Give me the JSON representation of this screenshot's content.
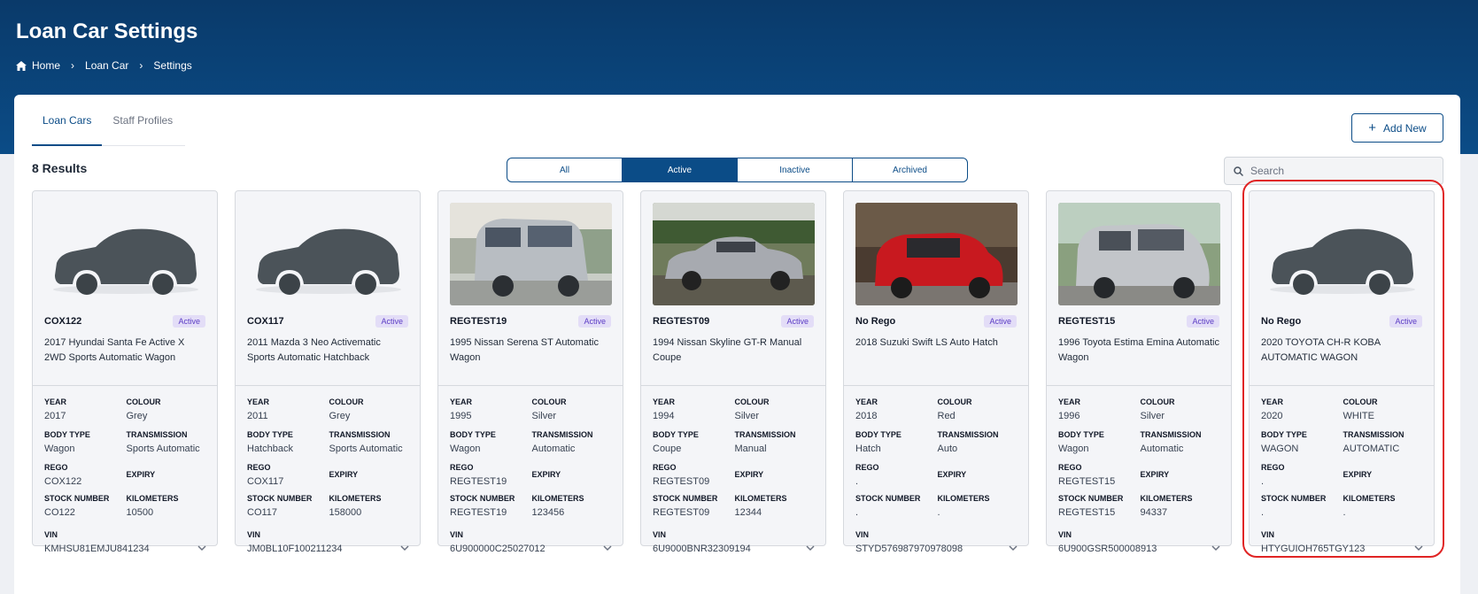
{
  "header": {
    "title": "Loan Car Settings",
    "breadcrumb": [
      "Home",
      "Loan Car",
      "Settings"
    ]
  },
  "tabs": [
    {
      "label": "Loan Cars",
      "active": true
    },
    {
      "label": "Staff Profiles",
      "active": false
    }
  ],
  "add_new_label": "Add New",
  "results_label": "8 Results",
  "filters": [
    {
      "label": "All"
    },
    {
      "label": "Active",
      "active": true
    },
    {
      "label": "Inactive"
    },
    {
      "label": "Archived"
    }
  ],
  "search": {
    "placeholder": "Search",
    "value": ""
  },
  "labels": {
    "year": "YEAR",
    "colour": "COLOUR",
    "body_type": "BODY TYPE",
    "transmission": "TRANSMISSION",
    "rego": "REGO",
    "expiry": "EXPIRY",
    "stock_number": "STOCK NUMBER",
    "kilometers": "KILOMETERS",
    "vin": "VIN"
  },
  "colors": {
    "primary": "#0b4c87",
    "badge_bg": "#e3ddf7",
    "badge_text": "#5b3cc4",
    "highlight": "#e02424"
  },
  "cars": [
    {
      "rego": "COX122",
      "status": "Active",
      "desc": "2017 Hyundai Santa Fe Active X 2WD Sports Automatic Wagon",
      "year": "2017",
      "colour": "Grey",
      "body_type": "Wagon",
      "transmission": "Sports Automatic",
      "rego_val": "COX122",
      "expiry": "",
      "stock_number": "CO122",
      "kilometers": "10500",
      "vin": "KMHSU81EMJU841234",
      "image": "silhouette"
    },
    {
      "rego": "COX117",
      "status": "Active",
      "desc": "2011 Mazda 3 Neo Activematic Sports Automatic Hatchback",
      "year": "2011",
      "colour": "Grey",
      "body_type": "Hatchback",
      "transmission": "Sports Automatic",
      "rego_val": "COX117",
      "expiry": "",
      "stock_number": "CO117",
      "kilometers": "158000",
      "vin": "JM0BL10F100211234",
      "image": "silhouette"
    },
    {
      "rego": "REGTEST19",
      "status": "Active",
      "desc": "1995 Nissan Serena ST Automatic Wagon",
      "year": "1995",
      "colour": "Silver",
      "body_type": "Wagon",
      "transmission": "Automatic",
      "rego_val": "REGTEST19",
      "expiry": "",
      "stock_number": "REGTEST19",
      "kilometers": "123456",
      "vin": "6U900000C25027012",
      "image": "silver-van"
    },
    {
      "rego": "REGTEST09",
      "status": "Active",
      "desc": "1994 Nissan Skyline GT-R Manual Coupe",
      "year": "1994",
      "colour": "Silver",
      "body_type": "Coupe",
      "transmission": "Manual",
      "rego_val": "REGTEST09",
      "expiry": "",
      "stock_number": "REGTEST09",
      "kilometers": "12344",
      "vin": "6U9000BNR32309194",
      "image": "silver-coupe"
    },
    {
      "rego": "No Rego",
      "status": "Active",
      "desc": "2018 Suzuki Swift LS Auto Hatch",
      "year": "2018",
      "colour": "Red",
      "body_type": "Hatch",
      "transmission": "Auto",
      "rego_val": ".",
      "expiry": "",
      "stock_number": ".",
      "kilometers": ".",
      "vin": "STYD576987970978098",
      "image": "red-hatch"
    },
    {
      "rego": "REGTEST15",
      "status": "Active",
      "desc": "1996 Toyota Estima Emina Automatic Wagon",
      "year": "1996",
      "colour": "Silver",
      "body_type": "Wagon",
      "transmission": "Automatic",
      "rego_val": "REGTEST15",
      "expiry": "",
      "stock_number": "REGTEST15",
      "kilometers": "94337",
      "vin": "6U900GSR500008913",
      "image": "silver-minivan"
    },
    {
      "rego": "No Rego",
      "status": "Active",
      "desc": "2020 TOYOTA CH-R KOBA AUTOMATIC WAGON",
      "year": "2020",
      "colour": "WHITE",
      "body_type": "WAGON",
      "transmission": "AUTOMATIC",
      "rego_val": ".",
      "expiry": "",
      "stock_number": ".",
      "kilometers": ".",
      "vin": "HTYGUIOH765TGY123",
      "image": "silhouette",
      "selected": true
    }
  ]
}
